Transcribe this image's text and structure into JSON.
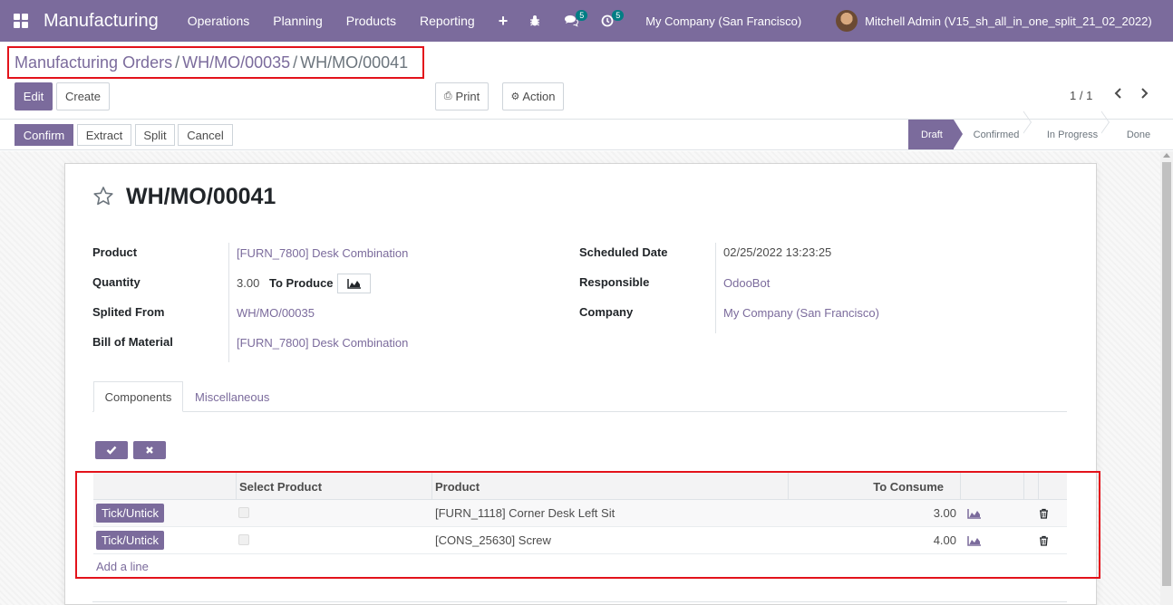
{
  "navbar": {
    "app_name": "Manufacturing",
    "menu": [
      "Operations",
      "Planning",
      "Products",
      "Reporting"
    ],
    "chat_count": "5",
    "activity_count": "5",
    "company": "My Company (San Francisco)",
    "user": "Mitchell Admin (V15_sh_all_in_one_split_21_02_2022)"
  },
  "breadcrumb": {
    "items": [
      "Manufacturing Orders",
      "WH/MO/00035",
      "WH/MO/00041"
    ],
    "separator": "/"
  },
  "toolbar": {
    "edit": "Edit",
    "create": "Create",
    "print": "Print",
    "action": "Action",
    "pager": "1 / 1"
  },
  "statusbar": {
    "buttons": [
      "Confirm",
      "Extract",
      "Split",
      "Cancel"
    ],
    "stages": [
      "Draft",
      "Confirmed",
      "In Progress",
      "Done"
    ],
    "active_stage": "Draft"
  },
  "record": {
    "title": "WH/MO/00041",
    "left_fields": [
      {
        "label": "Product",
        "value": "[FURN_7800] Desk Combination"
      },
      {
        "label": "Quantity",
        "value": "3.00",
        "extra": "To Produce"
      },
      {
        "label": "Splited From",
        "value": "WH/MO/00035"
      },
      {
        "label": "Bill of Material",
        "value": "[FURN_7800] Desk Combination"
      }
    ],
    "right_fields": [
      {
        "label": "Scheduled Date",
        "value": "02/25/2022 13:23:25"
      },
      {
        "label": "Responsible",
        "value": "OdooBot"
      },
      {
        "label": "Company",
        "value": "My Company (San Francisco)"
      }
    ]
  },
  "tabs": [
    "Components",
    "Miscellaneous"
  ],
  "components": {
    "columns": [
      "Select Product",
      "Product",
      "To Consume"
    ],
    "tick_label": "Tick/Untick",
    "rows": [
      {
        "product": "[FURN_1118] Corner Desk Left Sit",
        "to_consume": "3.00"
      },
      {
        "product": "[CONS_25630] Screw",
        "to_consume": "4.00"
      }
    ],
    "add_line": "Add a line"
  },
  "colors": {
    "primary": "#7b6b9c",
    "highlight": "#e3131b",
    "badge": "#017e84"
  }
}
